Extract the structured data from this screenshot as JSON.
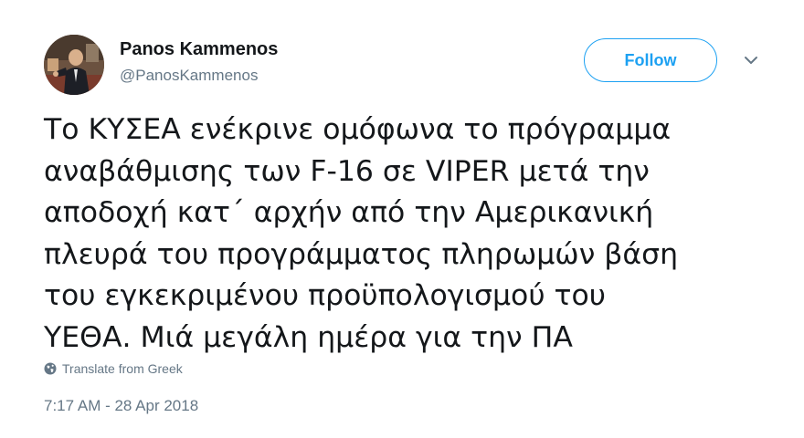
{
  "author": {
    "display_name": "Panos Kammenos",
    "handle": "@PanosKammenos"
  },
  "header": {
    "follow_label": "Follow",
    "follow_color": "#1da1f2",
    "menu_icon": "chevron-down-icon"
  },
  "tweet": {
    "lines": [
      "Το ΚΥΣΕΑ ενέκρινε ομόφωνα το πρόγραμμα",
      "αναβάθμισης των F-16 σε VIPER μετά την",
      "αποδοχή κατ΄ αρχήν από την Αμερικανική",
      "πλευρά του προγράμματος πληρωμών βάση",
      "του εγκεκριμένου προϋπολογισμού του",
      "ΥΕΘΑ. Μιά μεγάλη ημέρα για την ΠΑ"
    ],
    "translate_label": "Translate from Greek",
    "translate_icon": "globe-icon",
    "timestamp": "7:17 AM - 28 Apr 2018"
  }
}
